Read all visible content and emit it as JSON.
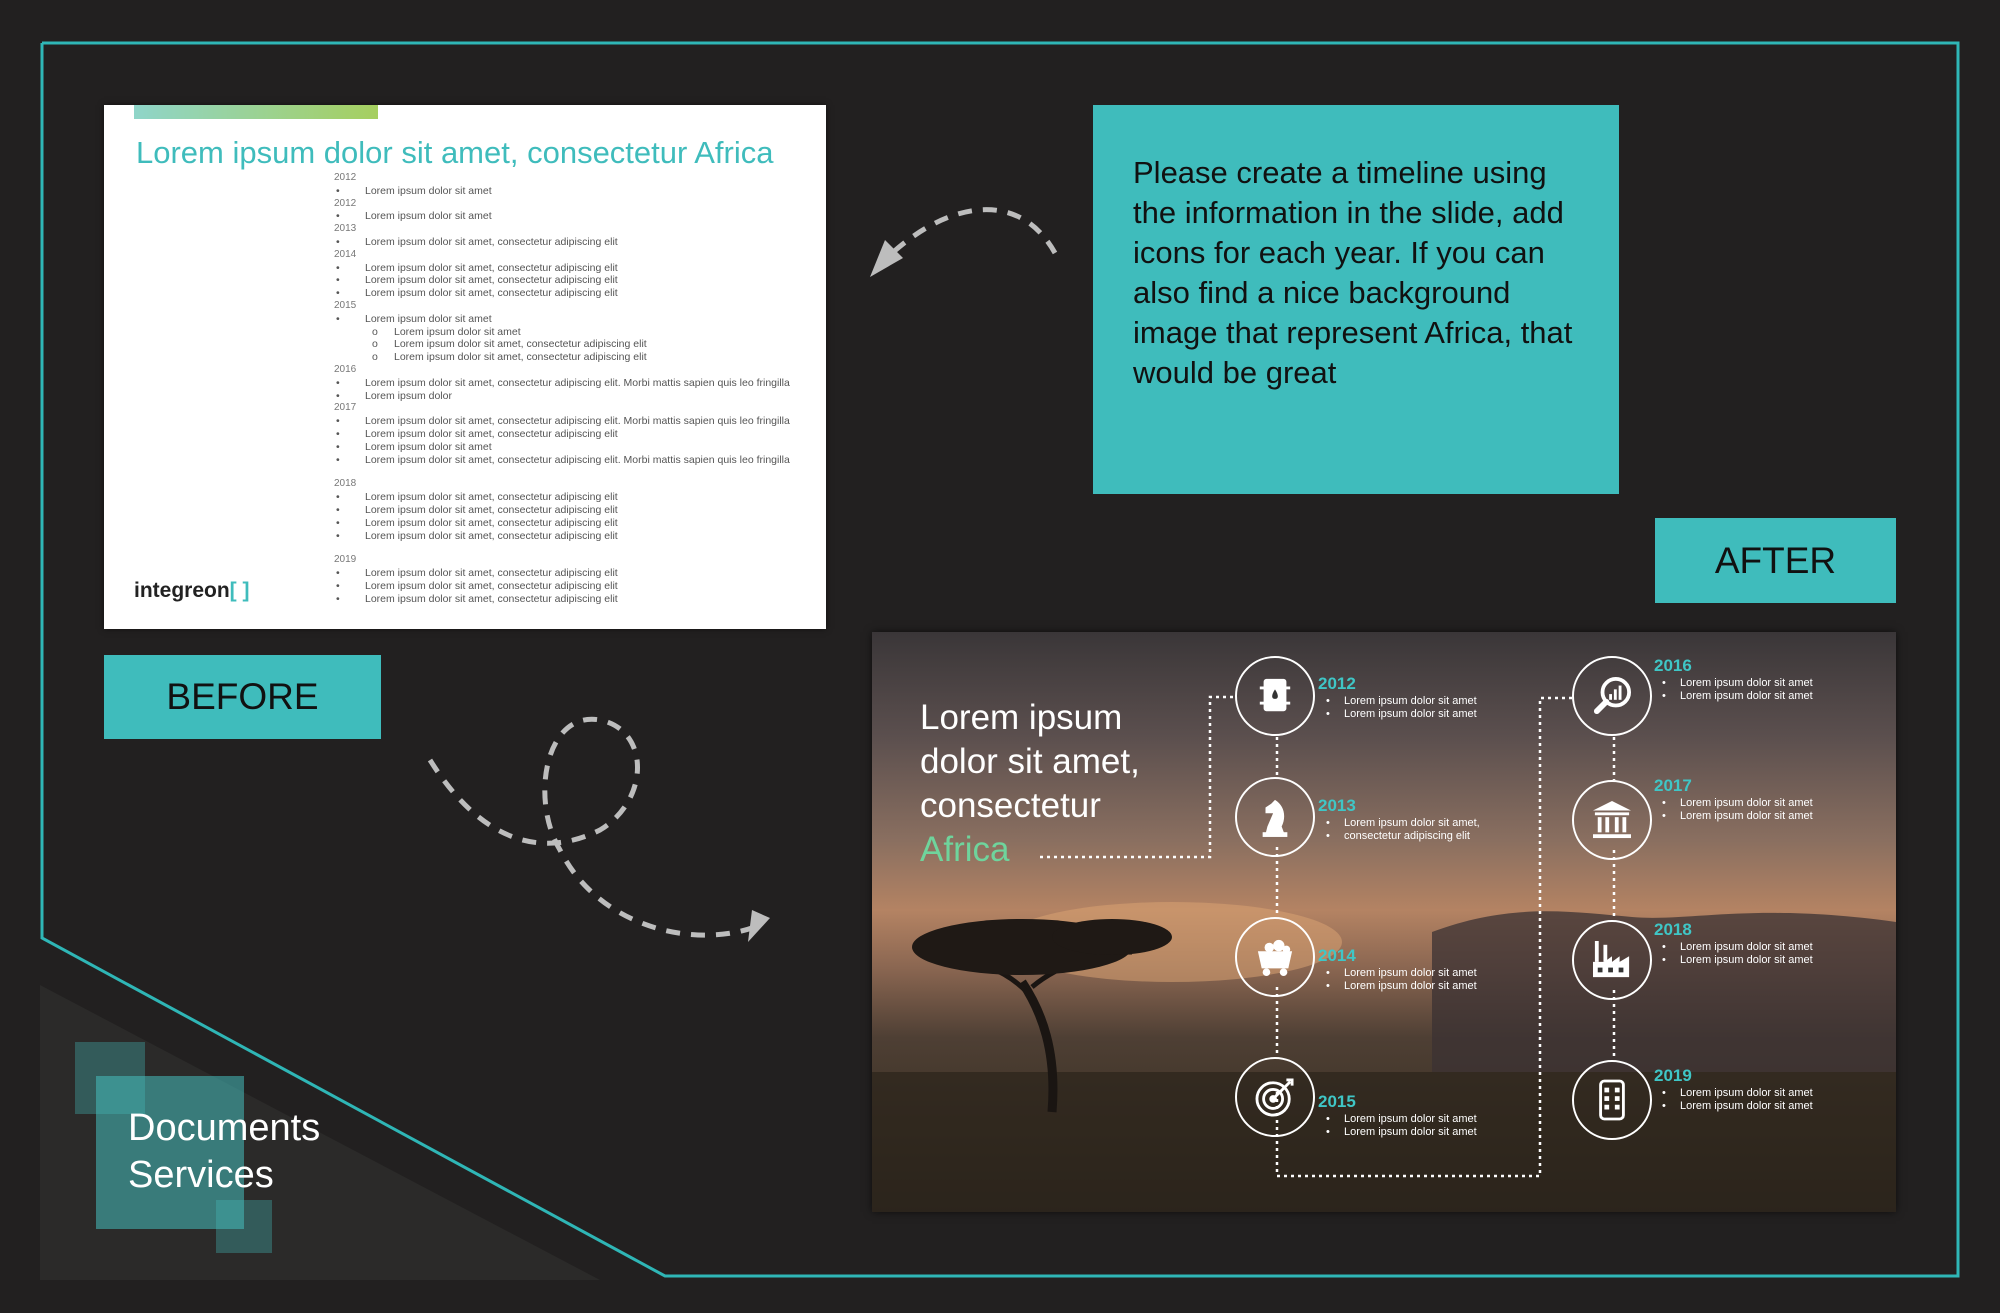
{
  "brand": "Documents Services",
  "brand_line1": "Documents",
  "brand_line2": "Services",
  "before_label": "BEFORE",
  "after_label": "AFTER",
  "brief": "Please create a timeline using the information in the slide, add icons for each year. If you can also find a nice background image that represent Africa, that would be great",
  "before_slide": {
    "title": "Lorem ipsum dolor sit amet, consectetur Africa",
    "logo_text": "integreon",
    "lines": [
      {
        "t": "yr",
        "s": "2012"
      },
      {
        "t": "b",
        "s": "Lorem ipsum dolor sit amet"
      },
      {
        "t": "yr",
        "s": "2012"
      },
      {
        "t": "b",
        "s": "Lorem ipsum dolor sit amet"
      },
      {
        "t": "yr",
        "s": "2013"
      },
      {
        "t": "b",
        "s": "Lorem ipsum dolor sit amet, consectetur adipiscing elit"
      },
      {
        "t": "yr",
        "s": "2014"
      },
      {
        "t": "b",
        "s": "Lorem ipsum dolor sit amet, consectetur adipiscing elit"
      },
      {
        "t": "b",
        "s": "Lorem ipsum dolor sit amet, consectetur adipiscing elit"
      },
      {
        "t": "b",
        "s": "Lorem ipsum dolor sit amet, consectetur adipiscing elit"
      },
      {
        "t": "yr",
        "s": "2015"
      },
      {
        "t": "b",
        "s": "Lorem ipsum dolor sit amet"
      },
      {
        "t": "sb",
        "s": "Lorem ipsum dolor sit amet"
      },
      {
        "t": "sb",
        "s": "Lorem ipsum dolor sit amet, consectetur adipiscing elit"
      },
      {
        "t": "sb",
        "s": "Lorem ipsum dolor sit amet, consectetur adipiscing elit"
      },
      {
        "t": "yr",
        "s": "2016"
      },
      {
        "t": "b",
        "s": "Lorem ipsum dolor sit amet, consectetur adipiscing elit. Morbi mattis sapien quis leo fringilla"
      },
      {
        "t": "b",
        "s": "Lorem ipsum dolor"
      },
      {
        "t": "yr",
        "s": "2017"
      },
      {
        "t": "b",
        "s": "Lorem ipsum dolor sit amet, consectetur adipiscing elit. Morbi mattis sapien quis leo fringilla"
      },
      {
        "t": "b",
        "s": "Lorem ipsum dolor sit amet, consectetur adipiscing elit"
      },
      {
        "t": "b",
        "s": "Lorem ipsum dolor sit amet"
      },
      {
        "t": "b",
        "s": "Lorem ipsum dolor sit amet, consectetur adipiscing elit. Morbi mattis sapien quis leo fringilla"
      },
      {
        "t": "gap",
        "s": ""
      },
      {
        "t": "yr",
        "s": "2018"
      },
      {
        "t": "b",
        "s": "Lorem ipsum dolor sit amet, consectetur adipiscing elit"
      },
      {
        "t": "b",
        "s": "Lorem ipsum dolor sit amet, consectetur adipiscing elit"
      },
      {
        "t": "b",
        "s": "Lorem ipsum dolor sit amet, consectetur adipiscing elit"
      },
      {
        "t": "b",
        "s": "Lorem ipsum dolor sit amet, consectetur adipiscing elit"
      },
      {
        "t": "gap",
        "s": ""
      },
      {
        "t": "yr",
        "s": "2019"
      },
      {
        "t": "b",
        "s": "Lorem ipsum dolor sit amet, consectetur adipiscing elit"
      },
      {
        "t": "b",
        "s": "Lorem ipsum dolor sit amet, consectetur adipiscing elit"
      },
      {
        "t": "b",
        "s": "Lorem ipsum dolor sit amet, consectetur adipiscing elit"
      }
    ]
  },
  "after_slide": {
    "title_l1": "Lorem ipsum",
    "title_l2": "dolor sit amet,",
    "title_l3": "consectetur",
    "title_accent": "Africa",
    "timeline": [
      {
        "year": "2012",
        "icon": "oil-barrel-icon",
        "bullets": [
          "Lorem ipsum dolor sit amet",
          "Lorem ipsum dolor sit amet"
        ]
      },
      {
        "year": "2013",
        "icon": "chess-knight-icon",
        "bullets": [
          "Lorem ipsum dolor sit amet,",
          "consectetur adipiscing elit"
        ]
      },
      {
        "year": "2014",
        "icon": "mine-cart-icon",
        "bullets": [
          "Lorem ipsum dolor sit amet",
          "Lorem ipsum dolor sit amet"
        ]
      },
      {
        "year": "2015",
        "icon": "target-icon",
        "bullets": [
          "Lorem ipsum dolor sit amet",
          "Lorem ipsum dolor sit amet"
        ]
      },
      {
        "year": "2016",
        "icon": "magnifier-chart-icon",
        "bullets": [
          "Lorem ipsum dolor sit amet",
          "Lorem ipsum dolor sit amet"
        ]
      },
      {
        "year": "2017",
        "icon": "bank-icon",
        "bullets": [
          "Lorem ipsum dolor sit amet",
          "Lorem ipsum dolor sit amet"
        ]
      },
      {
        "year": "2018",
        "icon": "factory-icon",
        "bullets": [
          "Lorem ipsum dolor sit amet",
          "Lorem ipsum dolor sit amet"
        ]
      },
      {
        "year": "2019",
        "icon": "phone-icon",
        "bullets": [
          "Lorem ipsum dolor sit amet",
          "Lorem ipsum dolor sit amet"
        ]
      }
    ]
  },
  "colors": {
    "accent": "#3fbcbc",
    "background": "#222020",
    "title_accent": "#6fd49c"
  }
}
